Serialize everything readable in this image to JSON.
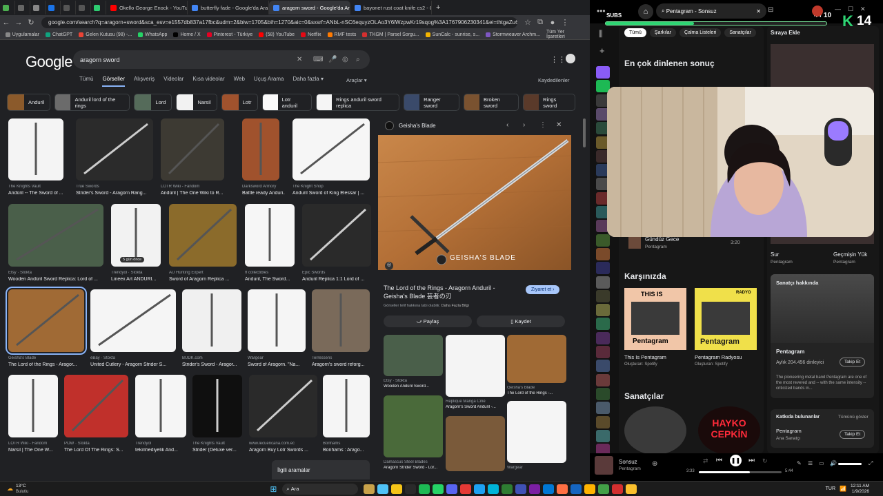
{
  "tabs": [
    {
      "label": "",
      "color": "#4caf50"
    },
    {
      "label": "",
      "color": "#666"
    },
    {
      "label": "",
      "color": "#888"
    },
    {
      "label": "",
      "color": "#1a73e8"
    },
    {
      "label": "",
      "color": "#555"
    },
    {
      "label": "",
      "color": "#555"
    },
    {
      "label": "",
      "color": "#2ecc71"
    },
    {
      "label": "Okello George Enock - YouTube",
      "color": "#ff0000"
    },
    {
      "label": "butterfly fade - Google'da Ara",
      "color": "#4285f4"
    },
    {
      "label": "aragorn sword - Google'da Ara",
      "color": "#4285f4"
    },
    {
      "label": "bayonet rust coat knife cs2 - G",
      "color": "#4285f4"
    }
  ],
  "url": "google.com/search?q=aragorn+sword&sca_esv=e1557db837a17fbc&udm=2&biw=1705&bih=1270&aic=0&sxsrf=ANbL-nSC6equyzOLAo3Y6lWzpwKr19sqog%3A1767906230341&ei=thtgaZu6FIKJ7NYPgfnbwAY&",
  "bookmarks": [
    "Uygulamalar",
    "ChatGPT",
    "Gelen Kutusu (98) -...",
    "WhatsApp",
    "Home / X",
    "Pinterest - Türkiye",
    "(58) YouTube",
    "Netflix",
    "RMF tests",
    "TKGM | Parsel Sorgu...",
    "SunCalc - sunrise, s...",
    "Stormweaver Archm..."
  ],
  "bookmarks_right": "Tüm Yer İşaretleri",
  "google": {
    "logo": "Google",
    "query": "aragorn sword",
    "tabs": [
      "Tümü",
      "Görseller",
      "Alışveriş",
      "Videolar",
      "Kısa videolar",
      "Web",
      "Uçuş Arama",
      "Daha fazla ▾"
    ],
    "tools": "Araçlar ▾",
    "saved": "Kaydedilenler",
    "chips": [
      "Anduril",
      "Anduril lord of the rings",
      "Lord",
      "Narsil",
      "Lotr",
      "Lotr anduril",
      "Rings anduril sword replica",
      "Ranger sword",
      "Broken sword",
      "Rings sword"
    ],
    "results": [
      {
        "src": "The Knights Vault",
        "title": "Andúril -- The Sword of ..."
      },
      {
        "src": "True Swords",
        "title": "Strider's Sword - Aragorn Rang..."
      },
      {
        "src": "LOTR Wiki - Fandom",
        "title": "Andúril | The One Wiki to R..."
      },
      {
        "src": "Darksword Armory",
        "title": "Battle ready Anduri..."
      },
      {
        "src": "The Knight Shop",
        "title": "Anduril Sword of King Elessar | ..."
      },
      {
        "src": "Etsy · Stokta",
        "title": "Wooden Andúril Sword Replica: Lord of ..."
      },
      {
        "src": "Trendyol · Stokta",
        "title": "Lineex Art ANDURI..."
      },
      {
        "src": "AU Hunting Expert",
        "title": "Sword of Aragorn Replica ..."
      },
      {
        "src": "ff collectibles",
        "title": "Anduril, The Sword..."
      },
      {
        "src": "Epic Swords",
        "title": "Anduril Replica 1:1 Lord of ..."
      },
      {
        "src": "Geisha's Blade",
        "title": "The Lord of the Rings - Aragor..."
      },
      {
        "src": "eBay · Stokta",
        "title": "United Cutlery - Aragorn Strider S..."
      },
      {
        "src": "BUDK.com",
        "title": "Strider's Sword - Aragor..."
      },
      {
        "src": "Wargear",
        "title": "Sword of Aragorn. \"Na..."
      },
      {
        "src": "Terressens",
        "title": "Aragorn's sword reforg..."
      },
      {
        "src": "LOTR Wiki - Fandom",
        "title": "Narsil | The One W..."
      },
      {
        "src": "POW · Stokta",
        "title": "The Lord Of The Rings: S..."
      },
      {
        "src": "Trendyol",
        "title": "tekinhediyelik And..."
      },
      {
        "src": "The Knights Vault",
        "title": "Strider (Deluxe ver..."
      },
      {
        "src": "www.lecuencana.com.ec",
        "title": "Aragorn Buy Lotr Swords ..."
      },
      {
        "src": "Bonhams",
        "title": "Bonhams : Arago..."
      }
    ],
    "badge": "5 gün önce",
    "related": "İlgili aramalar",
    "preview": {
      "source": "Geisha's Blade",
      "title": "The Lord of the Rings - Aragorn Anduril - Geisha's Blade 芸者の刃",
      "visit": "Ziyaret et",
      "copyright": "Görseller telif hakkına tabi olabilir.",
      "more_info": "Daha Fazla Bilgi",
      "share": "Paylaş",
      "save": "Kaydet",
      "watermark": "GEISHA'S BLADE",
      "related": [
        {
          "src": "Etsy · Stokta",
          "title": "Wooden Andúril Sword..."
        },
        {
          "src": "Réplique Manga Ciné",
          "title": "Aragorn's Sword Anduril -..."
        },
        {
          "src": "Geisha's Blade",
          "title": "The Lord of the Rings -..."
        },
        {
          "src": "Damascus Steel Blades",
          "title": "Aragorn Strider Sword - Lor..."
        },
        {
          "src": "Wargear",
          "title": ""
        }
      ]
    }
  },
  "spotify": {
    "search": "Pentagram - Sonsuz",
    "subs_label": "SUBS",
    "subs_count": "4 / 10",
    "overlay_num": "14",
    "filters": [
      "Tümü",
      "Şarkılar",
      "Çalma Listeleri",
      "Sanatçılar"
    ],
    "queue_title": "Sıraya Ekle",
    "top_result": "En çok dinlenen sonuç",
    "track": {
      "title": "Gündüz Gece",
      "artist": "Pentagram",
      "duration": "3:20"
    },
    "right_items": [
      {
        "title": "Sur",
        "artist": "Pentagram"
      },
      {
        "title": "Geçmişin Yük",
        "artist": "Pentagram"
      }
    ],
    "section_for_you": "Karşınızda",
    "cards": [
      {
        "cover": "THIS IS",
        "cover_name": "Pentagram",
        "title": "This Is Pentagram",
        "sub": "Oluşturan: Spotify"
      },
      {
        "cover": "RADYO",
        "cover_name": "Pentagram",
        "title": "Pentagram Radyosu",
        "sub": "Oluşturan: Spotify"
      }
    ],
    "about": {
      "label": "Sanatçı hakkında",
      "name": "Pentagram",
      "listeners": "Aylık 204.456 dinleyici",
      "follow": "Takip Et",
      "desc": "The pioneering metal band Pentagram are one of the most revered and -- with the same intensity -- criticized bands in..."
    },
    "section_artists": "Sanatçılar",
    "artist2_logo": "HAYKO CEPKİN",
    "contributors": {
      "label": "Katkıda bulunanlar",
      "show_all": "Tümünü göster",
      "name": "Pentagram",
      "role": "Ana Sanatçı",
      "follow": "Takip Et"
    },
    "now_playing": {
      "title": "Sonsuz",
      "artist": "Pentagram",
      "elapsed": "3:33",
      "total": "5:44",
      "progress": 0.62
    }
  },
  "taskbar": {
    "weather_temp": "13°C",
    "weather_desc": "Bulutlu",
    "search": "Ara",
    "lang": "TUR",
    "time": "12:11 AM",
    "date": "1/9/2026"
  }
}
